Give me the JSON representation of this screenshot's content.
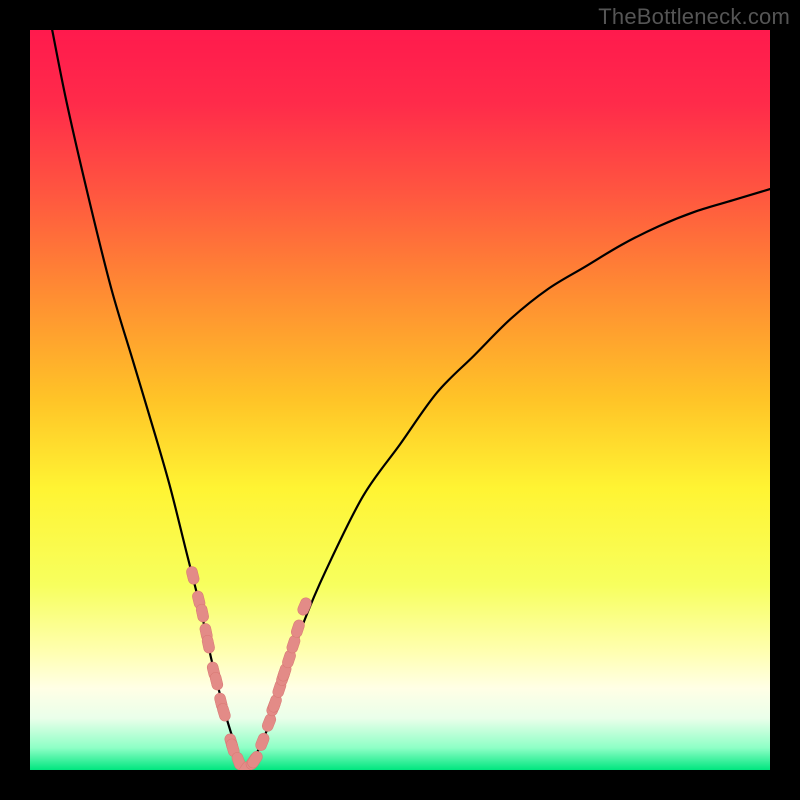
{
  "watermark": "TheBottleneck.com",
  "colors": {
    "frame": "#000000",
    "gradient_stops": [
      {
        "offset": 0.0,
        "color": "#ff1a4d"
      },
      {
        "offset": 0.1,
        "color": "#ff2b4a"
      },
      {
        "offset": 0.22,
        "color": "#ff5640"
      },
      {
        "offset": 0.35,
        "color": "#ff8a33"
      },
      {
        "offset": 0.5,
        "color": "#ffc427"
      },
      {
        "offset": 0.62,
        "color": "#fff433"
      },
      {
        "offset": 0.75,
        "color": "#f7ff5e"
      },
      {
        "offset": 0.84,
        "color": "#ffffb0"
      },
      {
        "offset": 0.89,
        "color": "#ffffe6"
      },
      {
        "offset": 0.93,
        "color": "#eaffea"
      },
      {
        "offset": 0.97,
        "color": "#8effc6"
      },
      {
        "offset": 1.0,
        "color": "#00e67f"
      }
    ],
    "curve": "#000000",
    "marker_fill": "#e38b87",
    "marker_stroke": "#d87873"
  },
  "chart_data": {
    "type": "line",
    "title": "",
    "xlabel": "",
    "ylabel": "",
    "xlim": [
      0,
      100
    ],
    "ylim": [
      0,
      100
    ],
    "grid": false,
    "note": "Axes are unlabeled in the image; x/y are normalized 0-100 across the plot area. Lower y = higher bottleneck (red), minimum near x≈29 where y≈0 (green/no bottleneck).",
    "series": [
      {
        "name": "bottleneck-curve",
        "x": [
          3,
          5,
          8,
          11,
          14,
          17,
          19,
          21,
          23,
          24.5,
          26,
          27.5,
          29,
          31,
          33,
          35,
          37,
          40,
          45,
          50,
          55,
          60,
          65,
          70,
          75,
          80,
          85,
          90,
          95,
          100
        ],
        "y": [
          100,
          90,
          77,
          65,
          55,
          45,
          38,
          30,
          22,
          15,
          9,
          4,
          0,
          3,
          8,
          14,
          20,
          27,
          37,
          44,
          51,
          56,
          61,
          65,
          68,
          71,
          73.5,
          75.5,
          77,
          78.5
        ]
      },
      {
        "name": "highlight-markers",
        "type": "scatter",
        "x": [
          22.0,
          22.8,
          23.3,
          23.8,
          24.1,
          24.8,
          25.2,
          25.8,
          26.2,
          27.2,
          27.4,
          28.2,
          29.1,
          30.2,
          30.4,
          31.4,
          32.3,
          32.9,
          33.1,
          33.7,
          34.2,
          34.4,
          35.0,
          35.6,
          36.2,
          37.1
        ],
        "y": [
          26.3,
          23.0,
          21.2,
          18.6,
          17.0,
          13.4,
          12.0,
          9.2,
          7.8,
          3.7,
          3.0,
          1.2,
          0.0,
          1.2,
          1.4,
          3.8,
          6.4,
          8.5,
          9.0,
          11.0,
          12.6,
          13.2,
          15.0,
          17.0,
          19.1,
          22.1
        ]
      }
    ]
  }
}
